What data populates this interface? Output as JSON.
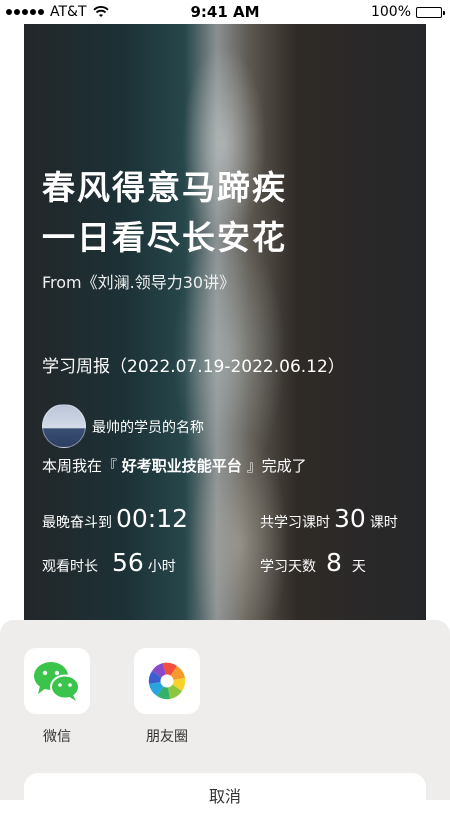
{
  "status_bar": {
    "carrier": "AT&T",
    "time": "9:41 AM",
    "battery": "100%",
    "battery_level": 1.0
  },
  "poster": {
    "title_line1": "春风得意马蹄疾",
    "title_line2": "一日看尽长安花",
    "from": "From《刘澜.领导力30讲》",
    "report_title": "学习周报（2022.07.19-2022.06.12）",
    "student_name": "最帅的学员的名称",
    "week_prefix": "本周我在『",
    "platform": "好考职业技能平台",
    "week_suffix": "』完成了",
    "stats": {
      "latest_label": "最晚奋斗到",
      "latest_value": "00:12",
      "courses_label": "共学习课时",
      "courses_value": "30",
      "courses_unit": "课时",
      "watch_label": "观看时长",
      "watch_value": "56",
      "watch_unit": "小时",
      "days_label": "学习天数",
      "days_value": "8",
      "days_unit": "天"
    }
  },
  "share_sheet": {
    "items": [
      {
        "label": "微信",
        "icon": "wechat-icon"
      },
      {
        "label": "朋友圈",
        "icon": "moments-icon"
      }
    ],
    "cancel_label": "取消"
  },
  "colors": {
    "wechat_green": "#3bc44b",
    "sheet_bg": "#eeedeb"
  }
}
